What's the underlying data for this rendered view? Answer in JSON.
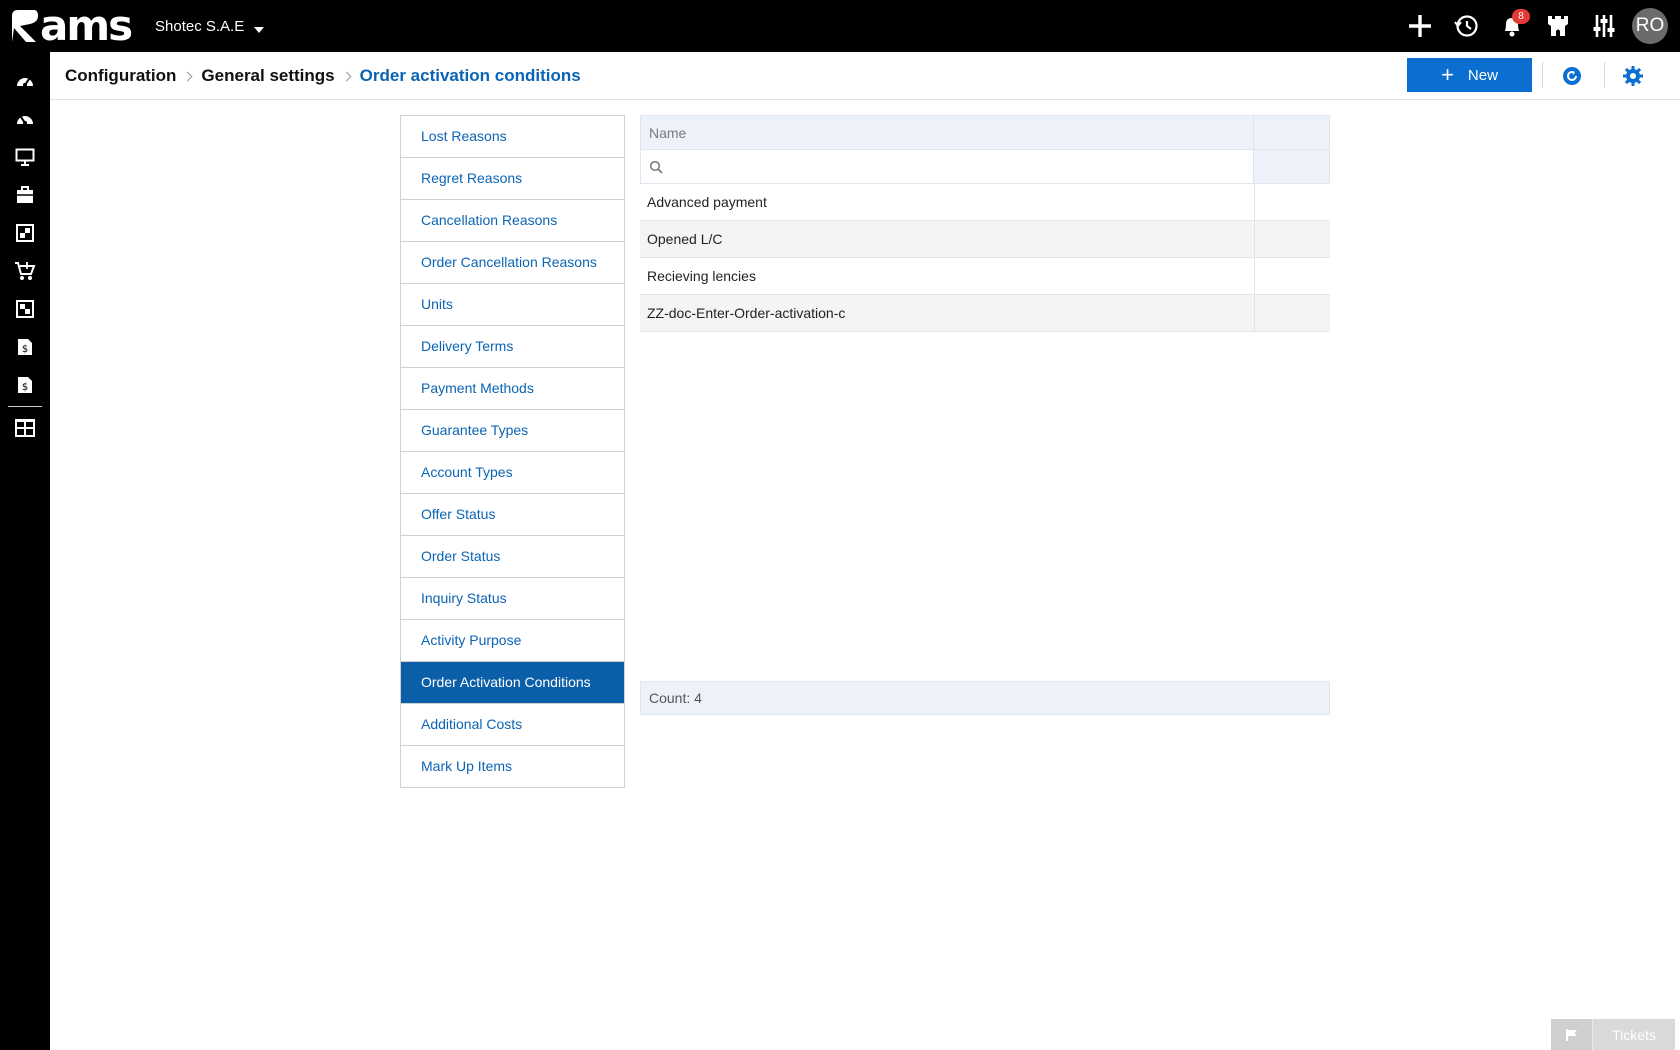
{
  "app": {
    "logo_text": "ams",
    "company": "Shotec S.A.E",
    "notifications_count": "8",
    "user_initials": "RO"
  },
  "top_icons": [
    "plus-icon",
    "history-icon",
    "bell-icon",
    "castle-icon",
    "sliders-icon"
  ],
  "left_nav": [
    "dashboard-icon",
    "dashboard-alt-icon",
    "monitor-icon",
    "briefcase-icon",
    "modules-icon",
    "cart-icon",
    "modules-alt-icon",
    "invoice-icon",
    "invoice-alt-icon",
    "reports-icon"
  ],
  "breadcrumb": {
    "item1": "Configuration",
    "item2": "General settings",
    "current": "Order activation conditions"
  },
  "toolbar": {
    "new_label": "New"
  },
  "settings_menu": [
    {
      "label": "Lost Reasons"
    },
    {
      "label": "Regret Reasons"
    },
    {
      "label": "Cancellation Reasons"
    },
    {
      "label": "Order Cancellation Reasons"
    },
    {
      "label": "Units"
    },
    {
      "label": "Delivery Terms"
    },
    {
      "label": "Payment Methods"
    },
    {
      "label": "Guarantee Types"
    },
    {
      "label": "Account Types"
    },
    {
      "label": "Offer Status"
    },
    {
      "label": "Order Status"
    },
    {
      "label": "Inquiry Status"
    },
    {
      "label": "Activity Purpose"
    },
    {
      "label": "Order Activation Conditions",
      "selected": true
    },
    {
      "label": "Additional Costs"
    },
    {
      "label": "Mark Up Items"
    }
  ],
  "grid": {
    "column_name": "Name",
    "search_value": "",
    "rows": [
      {
        "name": "Advanced payment"
      },
      {
        "name": "Opened L/C"
      },
      {
        "name": "Recieving lencies"
      },
      {
        "name": "ZZ-doc-Enter-Order-activation-c"
      }
    ],
    "count_text": "Count: 4"
  },
  "footer": {
    "tickets_label": "Tickets"
  },
  "colors": {
    "accent": "#0b6fd1",
    "link": "#0b64b4",
    "selected_bg": "#0b5ea8",
    "topbar": "#000000"
  }
}
